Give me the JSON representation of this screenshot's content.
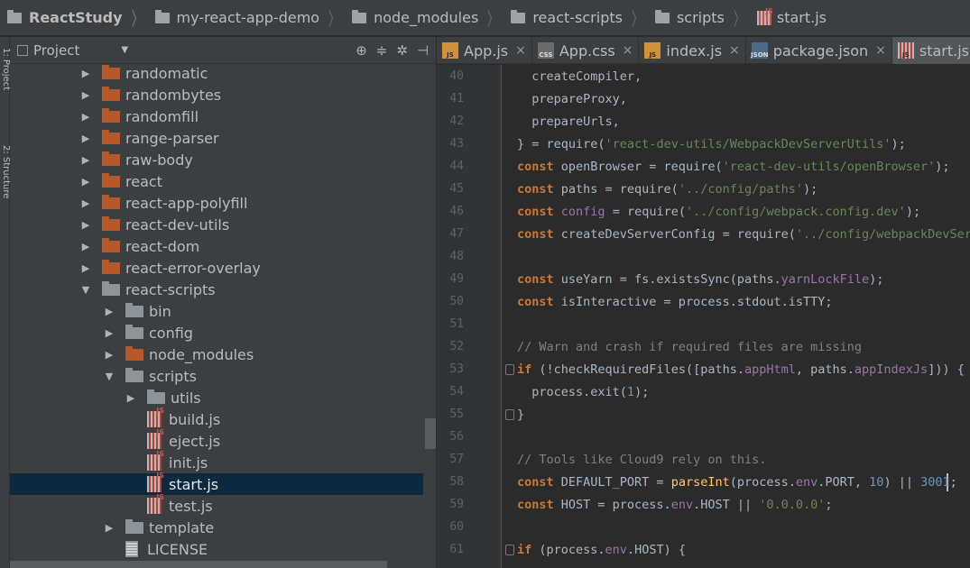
{
  "breadcrumbs": [
    "ReactStudy",
    "my-react-app-demo",
    "node_modules",
    "react-scripts",
    "scripts",
    "start.js"
  ],
  "side_strip": {
    "top_label": "1: Project",
    "bottom_label": "2: Structure"
  },
  "project_panel": {
    "title": "Project",
    "tools": [
      "⊕",
      "≑",
      "✲",
      "⊣"
    ],
    "tree": [
      {
        "label": "randomatic",
        "icon": "folder-orange",
        "arrow": "▶",
        "level": 0
      },
      {
        "label": "randombytes",
        "icon": "folder-orange",
        "arrow": "▶",
        "level": 0
      },
      {
        "label": "randomfill",
        "icon": "folder-orange",
        "arrow": "▶",
        "level": 0
      },
      {
        "label": "range-parser",
        "icon": "folder-orange",
        "arrow": "▶",
        "level": 0
      },
      {
        "label": "raw-body",
        "icon": "folder-orange",
        "arrow": "▶",
        "level": 0
      },
      {
        "label": "react",
        "icon": "folder-orange",
        "arrow": "▶",
        "level": 0
      },
      {
        "label": "react-app-polyfill",
        "icon": "folder-orange",
        "arrow": "▶",
        "level": 0
      },
      {
        "label": "react-dev-utils",
        "icon": "folder-orange",
        "arrow": "▶",
        "level": 0
      },
      {
        "label": "react-dom",
        "icon": "folder-orange",
        "arrow": "▶",
        "level": 0
      },
      {
        "label": "react-error-overlay",
        "icon": "folder-orange",
        "arrow": "▶",
        "level": 0
      },
      {
        "label": "react-scripts",
        "icon": "folder-gray",
        "arrow": "▼",
        "level": 0
      },
      {
        "label": "bin",
        "icon": "folder-gray",
        "arrow": "▶",
        "level": 1
      },
      {
        "label": "config",
        "icon": "folder-gray",
        "arrow": "▶",
        "level": 1
      },
      {
        "label": "node_modules",
        "icon": "folder-orange",
        "arrow": "▶",
        "level": 1
      },
      {
        "label": "scripts",
        "icon": "folder-gray",
        "arrow": "▼",
        "level": 1
      },
      {
        "label": "utils",
        "icon": "folder-gray",
        "arrow": "▶",
        "level": 2
      },
      {
        "label": "build.js",
        "icon": "jsf",
        "arrow": "",
        "level": 2
      },
      {
        "label": "eject.js",
        "icon": "jsf",
        "arrow": "",
        "level": 2
      },
      {
        "label": "init.js",
        "icon": "jsf",
        "arrow": "",
        "level": 2
      },
      {
        "label": "start.js",
        "icon": "jsf",
        "arrow": "",
        "level": 2,
        "selected": true
      },
      {
        "label": "test.js",
        "icon": "jsf",
        "arrow": "",
        "level": 2
      },
      {
        "label": "template",
        "icon": "folder-gray",
        "arrow": "▶",
        "level": 1
      },
      {
        "label": "LICENSE",
        "icon": "txt",
        "arrow": "",
        "level": 1
      }
    ]
  },
  "tabs": [
    {
      "label": "App.js",
      "icon": "js",
      "icon_text": "JS",
      "active": false
    },
    {
      "label": "App.css",
      "icon": "css",
      "icon_text": "CSS",
      "active": false
    },
    {
      "label": "index.js",
      "icon": "js",
      "icon_text": "JS",
      "active": false
    },
    {
      "label": "package.json",
      "icon": "json",
      "icon_text": "JSON",
      "active": false
    },
    {
      "label": "start.js",
      "icon": "start",
      "icon_text": "JS",
      "active": true
    }
  ],
  "tab_close": "×",
  "editor": {
    "lines": [
      {
        "n": "40",
        "segs": [
          [
            "",
            "  createCompiler,"
          ]
        ]
      },
      {
        "n": "41",
        "segs": [
          [
            "",
            "  prepareProxy,"
          ]
        ]
      },
      {
        "n": "42",
        "segs": [
          [
            "",
            "  prepareUrls,"
          ]
        ]
      },
      {
        "n": "43",
        "segs": [
          [
            "",
            "} = require("
          ],
          [
            "str",
            "'react-dev-utils/WebpackDevServerUtils'"
          ],
          [
            "",
            ");"
          ]
        ]
      },
      {
        "n": "44",
        "segs": [
          [
            "kw",
            "const"
          ],
          [
            "",
            " openBrowser = require("
          ],
          [
            "str",
            "'react-dev-utils/openBrowser'"
          ],
          [
            "",
            ");"
          ]
        ]
      },
      {
        "n": "45",
        "segs": [
          [
            "kw",
            "const"
          ],
          [
            "",
            " paths = require("
          ],
          [
            "str",
            "'../config/paths'"
          ],
          [
            "",
            ");"
          ]
        ]
      },
      {
        "n": "46",
        "segs": [
          [
            "kw",
            "const"
          ],
          [
            "",
            " "
          ],
          [
            "prop",
            "config"
          ],
          [
            "",
            " = require("
          ],
          [
            "str",
            "'../config/webpack.config.dev'"
          ],
          [
            "",
            ");"
          ]
        ]
      },
      {
        "n": "47",
        "segs": [
          [
            "kw",
            "const"
          ],
          [
            "",
            " createDevServerConfig = require("
          ],
          [
            "str",
            "'../config/webpackDevSer"
          ]
        ]
      },
      {
        "n": "48",
        "segs": [
          [
            "",
            ""
          ]
        ]
      },
      {
        "n": "49",
        "segs": [
          [
            "kw",
            "const"
          ],
          [
            "",
            " useYarn = fs.existsSync(paths."
          ],
          [
            "prop",
            "yarnLockFile"
          ],
          [
            "",
            ");"
          ]
        ]
      },
      {
        "n": "50",
        "segs": [
          [
            "kw",
            "const"
          ],
          [
            "",
            " isInteractive = process.stdout.isTTY;"
          ]
        ]
      },
      {
        "n": "51",
        "segs": [
          [
            "",
            ""
          ]
        ]
      },
      {
        "n": "52",
        "segs": [
          [
            "cm",
            "// Warn and crash if required files are missing"
          ]
        ]
      },
      {
        "n": "53",
        "segs": [
          [
            "kw",
            "if"
          ],
          [
            "",
            " (!checkRequiredFiles([paths."
          ],
          [
            "prop",
            "appHtml"
          ],
          [
            "",
            ", paths."
          ],
          [
            "prop",
            "appIndexJs"
          ],
          [
            "",
            "])) {"
          ]
        ],
        "fold": true
      },
      {
        "n": "54",
        "segs": [
          [
            "",
            "  process.exit("
          ],
          [
            "num",
            "1"
          ],
          [
            "",
            ");"
          ]
        ]
      },
      {
        "n": "55",
        "segs": [
          [
            "",
            "}"
          ]
        ],
        "fold": true
      },
      {
        "n": "56",
        "segs": [
          [
            "",
            ""
          ]
        ]
      },
      {
        "n": "57",
        "segs": [
          [
            "cm",
            "// Tools like Cloud9 rely on this."
          ]
        ]
      },
      {
        "n": "58",
        "segs": [
          [
            "kw",
            "const"
          ],
          [
            "",
            " DEFAULT_PORT = "
          ],
          [
            "fn",
            "parseInt"
          ],
          [
            "",
            "(process."
          ],
          [
            "prop",
            "env"
          ],
          [
            "",
            ".PORT, "
          ],
          [
            "num",
            "10"
          ],
          [
            "",
            ") || "
          ],
          [
            "num",
            "3001"
          ],
          [
            "",
            ";"
          ]
        ]
      },
      {
        "n": "59",
        "segs": [
          [
            "kw",
            "const"
          ],
          [
            "",
            " HOST = process."
          ],
          [
            "prop",
            "env"
          ],
          [
            "",
            ".HOST || "
          ],
          [
            "str",
            "'0.0.0.0'"
          ],
          [
            "",
            ";"
          ]
        ]
      },
      {
        "n": "60",
        "segs": [
          [
            "",
            ""
          ]
        ]
      },
      {
        "n": "61",
        "segs": [
          [
            "kw",
            "if"
          ],
          [
            "",
            " (process."
          ],
          [
            "prop",
            "env"
          ],
          [
            "",
            ".HOST) {"
          ]
        ],
        "fold": true
      }
    ]
  }
}
